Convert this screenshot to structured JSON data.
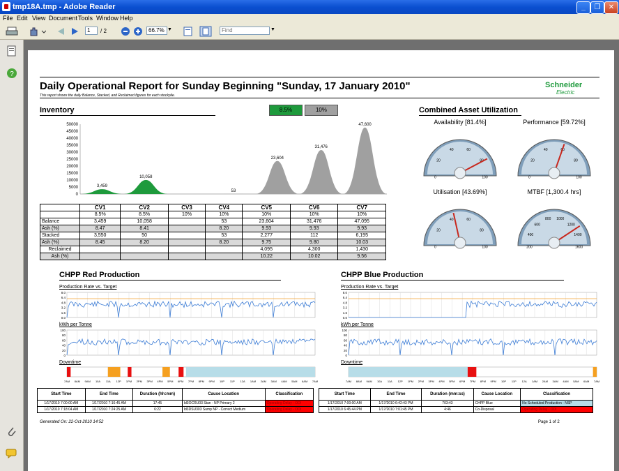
{
  "window": {
    "title": "tmp18A.tmp - Adobe Reader"
  },
  "menu": [
    "File",
    "Edit",
    "View",
    "Document",
    "Tools",
    "Window",
    "Help"
  ],
  "toolbar": {
    "page_current": "1",
    "page_total": "/ 2",
    "zoom": "66.7%",
    "find_placeholder": "Find"
  },
  "report": {
    "title": "Daily Operational Report for Sunday Beginning \"Sunday, 17 January 2010\"",
    "subtitle": "This report shows the daily Balance, Stacked, and Reclaimed figures for each stockpile.",
    "brand_top": "Schneider",
    "brand_bottom": "Electric",
    "footer_left": "Generated On: 22-Oct-2010 14:52",
    "footer_right": "Page 1 of 2"
  },
  "inventory": {
    "heading": "Inventory",
    "legend": [
      {
        "label": "8.5%",
        "color": "#1e9a3c"
      },
      {
        "label": "10%",
        "color": "#a0a0a0"
      }
    ],
    "columns": [
      "",
      "CV1",
      "CV2",
      "CV3",
      "CV4",
      "CV5",
      "CV6",
      "CV7"
    ],
    "rows": [
      [
        "",
        "8.5%",
        "8.5%",
        "10%",
        "10%",
        "10%",
        "10%",
        "10%"
      ],
      [
        "Balance",
        "3,459",
        "10,058",
        "",
        "53",
        "23,604",
        "31,476",
        "47,095"
      ],
      [
        "Ash (%)",
        "8.47",
        "8.41",
        "",
        "8.20",
        "9.93",
        "9.93",
        "9.93"
      ],
      [
        "Stacked",
        "3,550",
        "50",
        "",
        "53",
        "2,277",
        "112",
        "6,195"
      ],
      [
        "Ash (%)",
        "8.45",
        "8.20",
        "",
        "8.20",
        "9.75",
        "9.80",
        "10.03"
      ],
      [
        "Reclaimed",
        "",
        "",
        "",
        "",
        "4,095",
        "4,300",
        "1,430"
      ],
      [
        "Ash (%)",
        "",
        "",
        "",
        "",
        "10.22",
        "10.02",
        "9.56"
      ]
    ]
  },
  "chart_data": {
    "type": "area",
    "categories": [
      "CV1",
      "CV2",
      "CV3",
      "CV4",
      "CV5",
      "CV6",
      "CV7"
    ],
    "values": [
      3459,
      10058,
      0,
      53,
      23604,
      31476,
      47600
    ],
    "value_labels": [
      "3,459",
      "10,058",
      "",
      "53",
      "23,604",
      "31,476",
      "47,600"
    ],
    "colors": [
      "#1e9a3c",
      "#1e9a3c",
      "#1e9a3c",
      "#a0a0a0",
      "#a0a0a0",
      "#a0a0a0",
      "#a0a0a0"
    ],
    "yticks": [
      "50000",
      "45000",
      "40000",
      "35000",
      "30000",
      "25000",
      "20000",
      "15000",
      "10000",
      "5000",
      "0"
    ],
    "ylim": [
      0,
      50000
    ]
  },
  "utilization": {
    "heading": "Combined Asset Utilization",
    "gauges": [
      {
        "label": "Availability [81.4%]",
        "value": 81.4,
        "max": 100,
        "ticks": [
          "0",
          "20",
          "40",
          "60",
          "80",
          "100"
        ]
      },
      {
        "label": "Performance [59.72%]",
        "value": 59.72,
        "max": 100,
        "ticks": [
          "0",
          "20",
          "40",
          "60",
          "80",
          "100"
        ]
      },
      {
        "label": "Utilisation [43.69%]",
        "value": 43.69,
        "max": 100,
        "ticks": [
          "0",
          "20",
          "40",
          "60",
          "80",
          "100"
        ]
      },
      {
        "label": "MTBF [1,300.4 hrs]",
        "value": 1300.4,
        "max": 1600,
        "ticks": [
          "200",
          "400",
          "600",
          "800",
          "1000",
          "1200",
          "1400",
          "1600"
        ]
      }
    ]
  },
  "red": {
    "heading": "CHPP Red Production",
    "rate_label": "Production Rate vs. Target",
    "kwh_label": "kWh per Tonne",
    "downtime_label": "Downtime",
    "rate_y": [
      "8.0",
      "6.4",
      "4.8",
      "3.2",
      "1.6",
      "0.0"
    ],
    "kwh_y": [
      "100",
      "80",
      "60",
      "40",
      "20",
      "0"
    ],
    "time_labels": [
      "7AM",
      "8AM",
      "9AM",
      "10A",
      "11A",
      "12P",
      "1PM",
      "2PM",
      "3PM",
      "4PM",
      "5PM",
      "6PM",
      "7PM",
      "8PM",
      "9PM",
      "10P",
      "11P",
      "12A",
      "1AM",
      "2AM",
      "3AM",
      "4AM",
      "5AM",
      "6AM",
      "7AM"
    ],
    "table_headers": [
      "Start Time",
      "End Time",
      "Duration (hh:mm)",
      "Cause Location",
      "Classification"
    ],
    "table_rows": [
      [
        "1/17/2010 7:00:00 AM",
        "1/17/2010 7:16:45 AM",
        "17:45",
        "Id3OCRU03 Stan - NP Primary 2",
        "Operating Delay - ODI"
      ],
      [
        "1/17/2010 7:18:04 AM",
        "1/17/2010 7:24:25 AM",
        "6:22",
        "Id3DSU303 Sump NP - Correct Medium",
        "Operating Delay - ODI"
      ]
    ]
  },
  "blue": {
    "heading": "CHPP Blue Production",
    "rate_label": "Production Rate vs. Target",
    "kwh_label": "kWh per Tonne",
    "downtime_label": "Downtime",
    "rate_y": [
      "8.0",
      "6.4",
      "4.8",
      "3.2",
      "1.6",
      "0.0"
    ],
    "kwh_y": [
      "100",
      "80",
      "60",
      "40",
      "20",
      "0"
    ],
    "time_labels": [
      "7AM",
      "8AM",
      "9AM",
      "10A",
      "11A",
      "12P",
      "1PM",
      "2PM",
      "3PM",
      "4PM",
      "5PM",
      "6PM",
      "7PM",
      "8PM",
      "9PM",
      "10P",
      "11P",
      "12A",
      "1AM",
      "2AM",
      "3AM",
      "4AM",
      "5AM",
      "6AM",
      "7AM"
    ],
    "table_headers": [
      "Start Time",
      "End Time",
      "Duration (mm:ss)",
      "Cause Location",
      "Classification"
    ],
    "table_rows": [
      [
        "1/17/2010 7:00:00 AM",
        "1/17/2010 6:42:43 PM",
        "703:43",
        "CHPP Blue",
        "No Scheduled Production - NSP"
      ],
      [
        "1/17/2010 6:45:44 PM",
        "1/17/2010 7:01:45 PM",
        "4:46",
        "Co-Disposal",
        "Operating Delay - ODI"
      ]
    ]
  }
}
